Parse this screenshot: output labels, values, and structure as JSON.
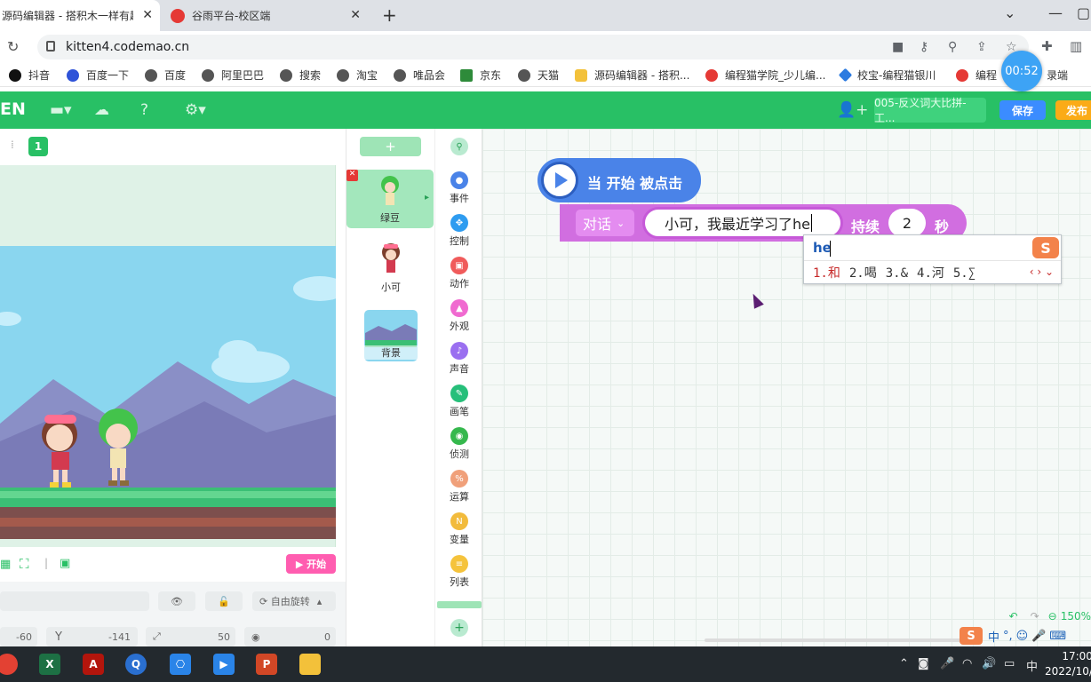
{
  "browser": {
    "tabs": [
      {
        "title": "源码编辑器 - 搭积木一样有趣",
        "active": true
      },
      {
        "title": "谷雨平台-校区端",
        "active": false
      }
    ],
    "url": "kitten4.codemao.cn"
  },
  "bookmarks": [
    {
      "label": "抖音",
      "icon": "tiktok-icon"
    },
    {
      "label": "百度一下",
      "icon": "baidu-icon"
    },
    {
      "label": "百度",
      "icon": "globe-icon"
    },
    {
      "label": "阿里巴巴",
      "icon": "globe-icon"
    },
    {
      "label": "搜索",
      "icon": "globe-icon"
    },
    {
      "label": "淘宝",
      "icon": "globe-icon"
    },
    {
      "label": "唯品会",
      "icon": "globe-icon"
    },
    {
      "label": "京东",
      "icon": "jd-icon"
    },
    {
      "label": "天猫",
      "icon": "globe-icon"
    },
    {
      "label": "源码编辑器 - 搭积...",
      "icon": "codemao-icon"
    },
    {
      "label": "编程猫学院_少儿编...",
      "icon": "codemao-red-icon"
    },
    {
      "label": "校宝-编程猫银川",
      "icon": "diamond-icon"
    },
    {
      "label": "编程",
      "icon": "codemao-red-icon"
    },
    {
      "label": "录端",
      "icon": ""
    }
  ],
  "timer": "00:52",
  "app": {
    "brand": "EN",
    "project_name": "005-反义词大比拼-工...",
    "save_label": "保存",
    "publish_label": "发布"
  },
  "stage": {
    "scene_number": "1",
    "start_label": "开始",
    "rotation_label": "自由旋转",
    "x_value": "-60",
    "y_label": "Y",
    "y_value": "-141",
    "size_value": "50",
    "direction_value": "0"
  },
  "sprites": [
    {
      "name": "绿豆",
      "selected": true
    },
    {
      "name": "小可",
      "selected": false
    }
  ],
  "background_label": "背景",
  "add_sprite_label": "+",
  "categories": [
    {
      "label": "事件",
      "color": "#4a83e8"
    },
    {
      "label": "控制",
      "color": "#2e9cf0"
    },
    {
      "label": "动作",
      "color": "#f05b5b"
    },
    {
      "label": "外观",
      "color": "#f06ad0"
    },
    {
      "label": "声音",
      "color": "#9a6ff0"
    },
    {
      "label": "画笔",
      "color": "#26bf7a"
    },
    {
      "label": "侦测",
      "color": "#35b84d"
    },
    {
      "label": "运算",
      "color": "#f0a07a"
    },
    {
      "label": "变量",
      "color": "#f2bb3c"
    },
    {
      "label": "列表",
      "color": "#f5c33c"
    }
  ],
  "blocks": {
    "hat_label": "当 开始 被点击",
    "say_dropdown": "对话",
    "say_text": "小可，我最近学习了he",
    "duration_label": "持续",
    "duration_value": "2",
    "seconds_label": "秒"
  },
  "ime": {
    "composition": "he",
    "candidates": [
      "1.和",
      "2.喝",
      "3.&",
      "4.河",
      "5.∑"
    ],
    "bar_label": "中"
  },
  "zoom": "150%",
  "taskbar": {
    "time": "17:00",
    "date": "2022/10/",
    "lang": "中"
  }
}
